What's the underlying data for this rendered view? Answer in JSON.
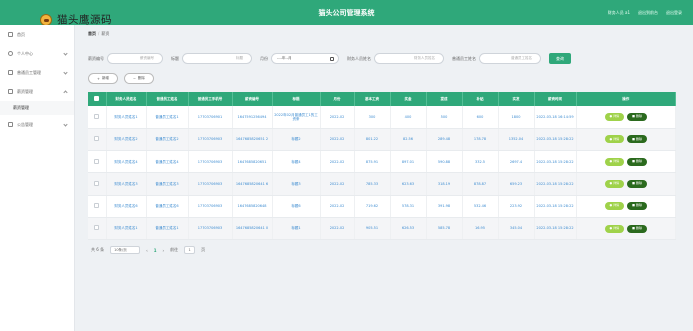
{
  "header": {
    "logo_text": "猫头鹰源码",
    "app_title": "猫头公司管理系统",
    "role": "财务人员 a1",
    "exit_front": "退出到前台",
    "logout": "退出登录",
    "brand_color": "#2fa87a"
  },
  "sidebar": {
    "items": [
      {
        "label": "首页",
        "icon": "home-icon"
      },
      {
        "label": "个人中心",
        "icon": "user-icon"
      },
      {
        "label": "普通员工管理",
        "icon": "staff-icon"
      },
      {
        "label": "薪资管理",
        "icon": "salary-icon",
        "sub": [
          "薪资管理"
        ]
      },
      {
        "label": "公告管理",
        "icon": "notice-icon"
      }
    ]
  },
  "breadcrumb": {
    "home": "首页",
    "current": "薪资"
  },
  "search": {
    "fields": [
      {
        "label": "薪资编号",
        "placeholder": "薪资编号"
      },
      {
        "label": "标题",
        "placeholder": "标题"
      },
      {
        "label": "月份",
        "placeholder": "----年--月"
      },
      {
        "label": "财务人员姓名",
        "placeholder": "财务人员姓名"
      },
      {
        "label": "普通员工姓名",
        "placeholder": "普通员工姓名"
      }
    ],
    "button": "查询"
  },
  "actions": {
    "add": "新增",
    "delete": "删除"
  },
  "table": {
    "headers": [
      "财务人员姓名",
      "普通员工姓名",
      "普通员工手机号",
      "薪资编号",
      "标题",
      "月份",
      "基本工资",
      "奖金",
      "提成",
      "补贴",
      "实发",
      "薪资时间",
      "操作"
    ],
    "rows": [
      [
        "财务人员姓名1",
        "普通员工姓名1",
        "17703706901",
        "1647591256494",
        "2022年02月普通员工1的工资条",
        "2022-02",
        "300",
        "400",
        "500",
        "600",
        "1800",
        "2022-03-18 16:14:59"
      ],
      [
        "财务人员姓名2",
        "普通员工姓名2",
        "17703706903",
        "1647685820651 2",
        "标题2",
        "2022-02",
        "801.22",
        "82.56",
        "289.48",
        "178.78",
        "1352.04",
        "2022-03-18 15:28:22"
      ],
      [
        "财务人员姓名4",
        "普通员工姓名4",
        "17703706903",
        "1647685820651",
        "标题4",
        "2022-02",
        "875.91",
        "897.01",
        "590.88",
        "332.5",
        "2697.4",
        "2022-03-18 15:28:22"
      ],
      [
        "财务人员姓名3",
        "普通员工姓名3",
        "17703706903",
        "1647685820641 6",
        "标题3",
        "2022-02",
        "785.33",
        "623.63",
        "318.19",
        "878.87",
        "659.23",
        "2022-03-18 15:28:22"
      ],
      [
        "财务人员姓名6",
        "普通员工姓名6",
        "17703706903",
        "1647685820648",
        "标题6",
        "2022-02",
        "719.62",
        "578.31",
        "391.98",
        "532.46",
        "223.92",
        "2022-03-18 15:28:22"
      ],
      [
        "财务人员姓名1",
        "普通员工姓名1",
        "17703706903",
        "1647685820641 0",
        "标题1",
        "2022-02",
        "905.51",
        "626.53",
        "585.78",
        "16.95",
        "345.04",
        "2022-03-18 15:28:22"
      ]
    ],
    "detail_label": "详情",
    "delete_label": "删除"
  },
  "pager": {
    "total": "共 6 条",
    "page_size": "10条/页",
    "current_page": "1",
    "goto_label": "前往",
    "goto_value": "1",
    "page_unit": "页"
  }
}
